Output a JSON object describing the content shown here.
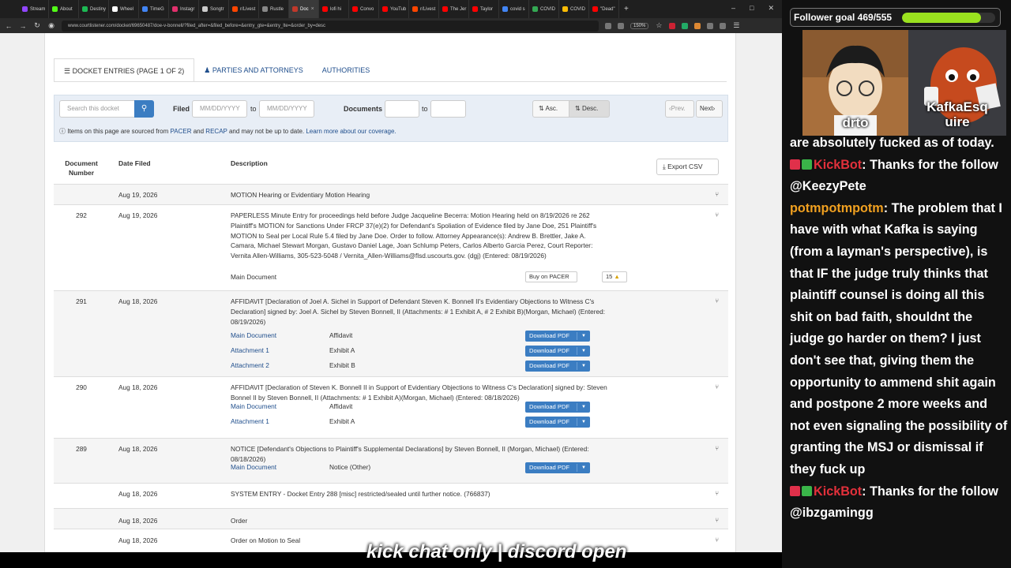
{
  "browser": {
    "tabs": [
      {
        "label": "Stream",
        "color": "#9146ff"
      },
      {
        "label": "About",
        "color": "#53fc18"
      },
      {
        "label": "Destiny",
        "color": "#1db954"
      },
      {
        "label": "Wheel",
        "color": "#ffffff"
      },
      {
        "label": "TimeG",
        "color": "#4285f4"
      },
      {
        "label": "Instagr",
        "color": "#e1306c"
      },
      {
        "label": "Songtr",
        "color": "#cccccc"
      },
      {
        "label": "r/Livest",
        "color": "#ff4500"
      },
      {
        "label": "Rustle",
        "color": "#888888"
      },
      {
        "label": "Doc",
        "color": "#c0392b"
      },
      {
        "label": "lofi hi",
        "color": "#ff0000"
      },
      {
        "label": "Convo",
        "color": "#ff0000"
      },
      {
        "label": "YouTub",
        "color": "#ff0000"
      },
      {
        "label": "r/Livest",
        "color": "#ff4500"
      },
      {
        "label": "The Jer",
        "color": "#ff0000"
      },
      {
        "label": "Taylor",
        "color": "#ff0000"
      },
      {
        "label": "covid s",
        "color": "#4285f4"
      },
      {
        "label": "COVID",
        "color": "#34a853"
      },
      {
        "label": "COVID",
        "color": "#fbbc05"
      },
      {
        "label": "\"Dead\"",
        "color": "#ff0000"
      }
    ],
    "active_tab_index": 9,
    "url": "www.courtlistener.com/docket/69650487/doe-v-bonnell/?filed_after=&filed_before=&entry_gte=&entry_lte=&order_by=desc",
    "zoom": "150%"
  },
  "page": {
    "tabs": {
      "docket": "DOCKET ENTRIES (PAGE 1 OF 2)",
      "parties": "PARTIES AND ATTORNEYS",
      "authorities": "AUTHORITIES"
    },
    "filters": {
      "search_placeholder": "Search this docket",
      "filed_label": "Filed",
      "date_placeholder": "MM/DD/YYYY",
      "to": "to",
      "documents_label": "Documents",
      "asc": "Asc.",
      "desc": "Desc.",
      "prev": "Prev.",
      "next": "Next"
    },
    "notice": {
      "pre": "Items on this page are sourced from ",
      "pacer": "PACER",
      "and": " and ",
      "recap": "RECAP",
      "post": " and may not be up to date. ",
      "learn": "Learn more about our coverage."
    },
    "table_headers": {
      "doc_number": "Document Number",
      "date_filed": "Date Filed",
      "description": "Description",
      "export": "Export CSV"
    },
    "entries": [
      {
        "number": "",
        "date": "Aug 19, 2026",
        "description": "MOTION Hearing or Evidentiary Motion Hearing"
      },
      {
        "number": "292",
        "date": "Aug 19, 2026",
        "description": "PAPERLESS Minute Entry for proceedings held before Judge Jacqueline Becerra: Motion Hearing held on 8/19/2026 re 262 Plaintiff's MOTION for Sanctions Under FRCP 37(e)(2) for Defendant's Spoliation of Evidence filed by Jane Doe, 251 Plaintiff's MOTION to Seal per Local Rule 5.4 filed by Jane Doe. Order to follow. Attorney Appearance(s): Andrew B. Brettler, Jake A. Camara, Michael Stewart Morgan, Gustavo Daniel Lage, Joan Schlump Peters, Carlos Alberto Garcia Perez, Court Reporter: Vernita Allen-Williams, 305-523-5048 / Vernita_Allen-Williams@flsd.uscourts.gov. (dgj) (Entered: 08/19/2026)",
        "docs": [
          {
            "name": "Main Document",
            "desc": "",
            "action": "Buy on PACER",
            "price": "15"
          }
        ]
      },
      {
        "number": "291",
        "date": "Aug 18, 2026",
        "description": "AFFIDAVIT [Declaration of Joel A. Sichel in Support of Defendant Steven K. Bonnell II's Evidentiary Objections to Witness C's Declaration] signed by: Joel A. Sichel by Steven Bonnell, II (Attachments: # 1 Exhibit A, # 2 Exhibit B)(Morgan, Michael) (Entered: 08/19/2026)",
        "docs": [
          {
            "name": "Main Document",
            "desc": "Affidavit",
            "action": "Download PDF"
          },
          {
            "name": "Attachment 1",
            "desc": "Exhibit A",
            "action": "Download PDF"
          },
          {
            "name": "Attachment 2",
            "desc": "Exhibit B",
            "action": "Download PDF"
          }
        ]
      },
      {
        "number": "290",
        "date": "Aug 18, 2026",
        "description": "AFFIDAVIT [Declaration of Steven K. Bonnell II in Support of Evidentiary Objections to Witness C's Declaration] signed by: Steven Bonnel II by Steven Bonnell, II (Attachments: # 1 Exhibit A)(Morgan, Michael) (Entered: 08/18/2026)",
        "docs": [
          {
            "name": "Main Document",
            "desc": "Affidavit",
            "action": "Download PDF"
          },
          {
            "name": "Attachment 1",
            "desc": "Exhibit A",
            "action": "Download PDF"
          }
        ]
      },
      {
        "number": "289",
        "date": "Aug 18, 2026",
        "description": "NOTICE [Defendant's Objections to Plaintiff's Supplemental Declarations] by Steven Bonnell, II (Morgan, Michael) (Entered: 08/18/2026)",
        "docs": [
          {
            "name": "Main Document",
            "desc": "Notice (Other)",
            "action": "Download PDF"
          }
        ]
      },
      {
        "number": "",
        "date": "Aug 18, 2026",
        "description": "SYSTEM ENTRY - Docket Entry 288 [misc] restricted/sealed until further notice. (766837)"
      },
      {
        "number": "",
        "date": "Aug 18, 2026",
        "description": "Order"
      },
      {
        "number": "",
        "date": "Aug 18, 2026",
        "description": "Order on Motion to Seal"
      }
    ]
  },
  "stream": {
    "goal_text": "Follower goal 469/555",
    "goal_current": 469,
    "goal_target": 555,
    "cam_left_name": "drto",
    "cam_right_name": "KafkaEsquire",
    "cam_right_line1": "KafkaEsq",
    "cam_right_line2": "uire",
    "chat": [
      {
        "type": "cont",
        "text": "are absolutely fucked as of today."
      },
      {
        "type": "msg",
        "user": "KickBot",
        "badges": true,
        "text": "Thanks for the follow @KeezyPete"
      },
      {
        "type": "msg",
        "user": "potmpotmpotm",
        "badges": false,
        "text": "The problem that I have with what Kafka is saying (from a layman's perspective), is that IF the judge truly thinks that plaintiff counsel is doing all this shit on bad faith, shouldnt the judge go harder on them? I just don't see that, giving them the opportunity to ammend shit again and postpone 2 more weeks and not even signaling the possibility of granting the MSJ or dismissal if they fuck up"
      },
      {
        "type": "msg",
        "user": "KickBot",
        "badges": true,
        "text": "Thanks for the follow @ibzgamingg"
      }
    ],
    "caption": "kick chat only | discord open"
  },
  "colors": {
    "link": "#1f4e8c",
    "button_blue": "#3b7dc2",
    "kick_green": "#9be21f",
    "kickbot_red": "#e2303b",
    "user_orange": "#f0a020"
  }
}
